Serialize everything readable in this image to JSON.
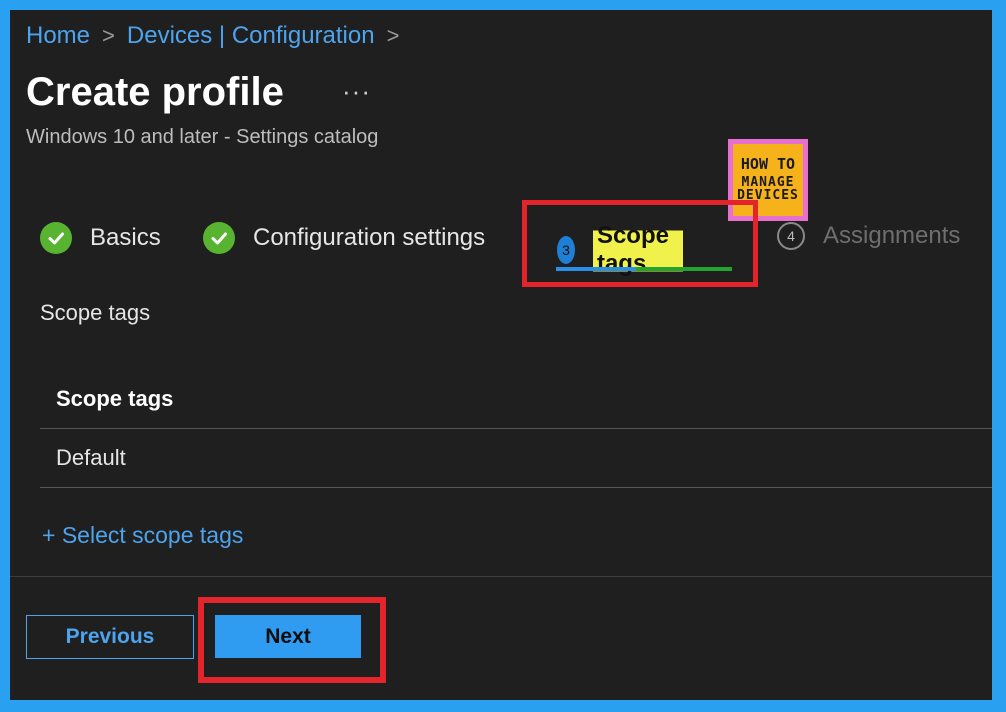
{
  "breadcrumb": {
    "items": [
      "Home",
      "Devices | Configuration"
    ],
    "separator": ">"
  },
  "page": {
    "title": "Create profile",
    "more_label": "···",
    "subtitle": "Windows 10 and later - Settings catalog"
  },
  "logo": {
    "line1": "HOW TO",
    "line2": "MANAGE",
    "line3": "DEVICES"
  },
  "wizard": {
    "steps": [
      {
        "label": "Basics",
        "status": "complete"
      },
      {
        "label": "Configuration settings",
        "status": "complete"
      },
      {
        "number": "3",
        "label": "Scope tags",
        "status": "active"
      },
      {
        "number": "4",
        "label": "Assignments",
        "status": "inactive"
      }
    ]
  },
  "scope_section": {
    "label": "Scope tags",
    "table_header": "Scope tags",
    "rows": [
      "Default"
    ],
    "add_link": "+ Select scope tags"
  },
  "footer": {
    "previous_label": "Previous",
    "next_label": "Next"
  },
  "colors": {
    "accent": "#2f9cf2",
    "link": "#4ea3ee",
    "check_green": "#58b430",
    "highlight_red": "#e3242b",
    "background": "#1f1f1f"
  }
}
